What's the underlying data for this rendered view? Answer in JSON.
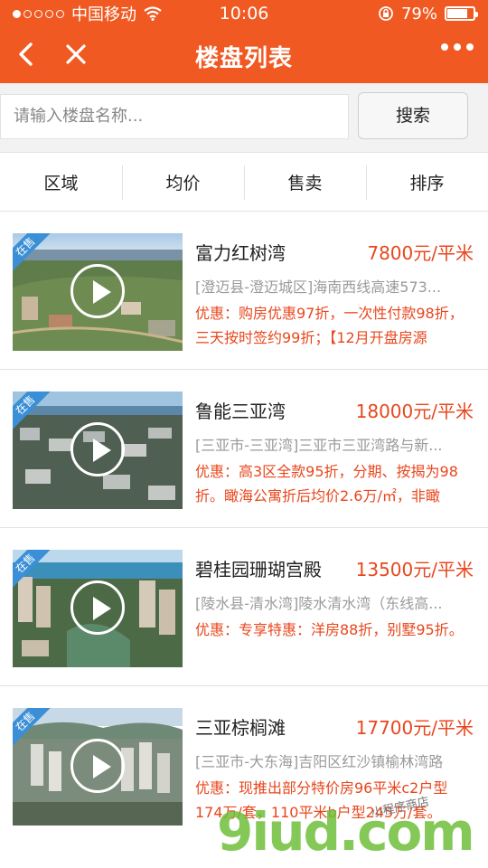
{
  "statusbar": {
    "carrier": "中国移动",
    "time": "10:06",
    "battery": "79%",
    "battery_level": 0.79
  },
  "navbar": {
    "title": "楼盘列表"
  },
  "search": {
    "placeholder": "请输入楼盘名称...",
    "button_label": "搜索"
  },
  "filters": [
    "区域",
    "均价",
    "售卖",
    "排序"
  ],
  "listings": [
    {
      "badge": "在售",
      "name": "富力红树湾",
      "price": "7800元/平米",
      "address": "[澄迈县-澄迈城区]海南西线高速573...",
      "promo": "优惠：购房优惠97折，一次性付款98折，三天按时签约99折；【12月开盘房源"
    },
    {
      "badge": "在售",
      "name": "鲁能三亚湾",
      "price": "18000元/平米",
      "address": "[三亚市-三亚湾]三亚市三亚湾路与新...",
      "promo": "优惠：高3区全款95折，分期、按揭为98折。瞰海公寓折后均价2.6万/㎡，非瞰"
    },
    {
      "badge": "在售",
      "name": "碧桂园珊瑚宫殿",
      "price": "13500元/平米",
      "address": "[陵水县-清水湾]陵水清水湾（东线高...",
      "promo": "优惠：专享特惠：洋房88折，别墅95折。"
    },
    {
      "badge": "在售",
      "name": "三亚棕榈滩",
      "price": "17700元/平米",
      "address": "[三亚市-大东海]吉阳区红沙镇榆林湾路",
      "promo": "优惠：现推出部分特价房96平米c2户型174万/套，110平米b户型245万/套。"
    }
  ],
  "watermark": {
    "main": "9iud.com",
    "sub": "小程序商店"
  }
}
